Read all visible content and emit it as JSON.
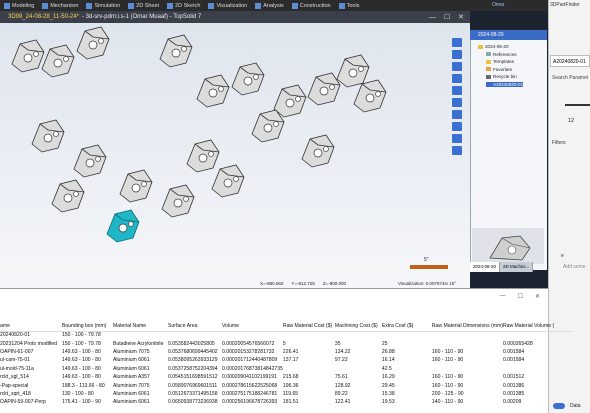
{
  "topbar": {
    "items": [
      "Modeling",
      "Mechanism",
      "Simulation",
      "2D Sheet",
      "2D Sketch",
      "Visualization",
      "Analysis",
      "Construction",
      "Tools"
    ],
    "user": "Omar"
  },
  "titlebar": {
    "doc": "3D99_24-08-28_11-50-24*",
    "rest": "- 3d-srv-pdm:i.s-1 (Omar Muaaf) - TopSolid 7",
    "buttons": [
      "—",
      "☐",
      "✕"
    ]
  },
  "viewport": {
    "coords": [
      "X=-880.560",
      "Y=-812.728",
      "Z=-800.000"
    ],
    "visualization": "Visualization: 0.007874in 15°",
    "ruler_label": "5\""
  },
  "tree": {
    "header": "2024-08-20",
    "items": [
      {
        "label": "2024-08-20",
        "indent": 0,
        "color": "#f0c040"
      },
      {
        "label": "References",
        "indent": 1,
        "color": "#8aa"
      },
      {
        "label": "Templates",
        "indent": 1,
        "color": "#f0c040"
      },
      {
        "label": "Favorites",
        "indent": 1,
        "color": "#e6a23c"
      },
      {
        "label": "Recycle bin",
        "indent": 1,
        "color": "#667"
      },
      {
        "label": "A20240820-01",
        "indent": 1,
        "color": "#3a6cc7",
        "selected": true
      }
    ],
    "tabs": [
      "2024-08-20",
      "2D Machini..."
    ]
  },
  "finder": {
    "title": "3DPartFinder",
    "code": "A20240820-01",
    "search_label": "Search Paramet",
    "number": "12",
    "filters": "Filters",
    "same_label": "e",
    "add_label": "Add some",
    "data_toggle": "Data"
  },
  "table": {
    "headers": [
      "ame",
      "Bounding box (mm)",
      "Material Name",
      "Surface Area",
      "Volume",
      "Raw Material Cost ($)",
      "Machining Cost ($)",
      "Extra Cost ($)",
      "Raw Material Dimensions (mm)",
      "Raw Material Volume ("
    ],
    "rows": [
      [
        "20240820-01",
        "150 - 100 - 79.78",
        "",
        "",
        "",
        "",
        "",
        "",
        "",
        ""
      ],
      [
        "20231204 Proto modified",
        "150 - 100 - 79.78",
        "Butadiene Acrylonitrile",
        "0.053582443025805",
        "0.00020054576566072",
        "5",
        "35",
        "25",
        "",
        "0.000265428"
      ],
      [
        "OAPIN-61-007",
        "149.63 - 100 - 80",
        "Aluminium 7075",
        "0.0537680699445402",
        "0.00020153278281732",
        "226.41",
        "134.22",
        "26.88",
        "160 - 110 - 90",
        "0.001584"
      ],
      [
        "ul-cam-75-01",
        "149.63 - 100 - 80",
        "Aluminium 6061",
        "0.0538095263933129",
        "0.000201712440487809",
        "137.17",
        "97.22",
        "16.14",
        "160 - 110 - 90",
        "0.001584"
      ],
      [
        "ul-mold-75-11a",
        "149.63 - 100 - 80",
        "Aluminium 6061",
        "0.0537258752204394",
        "0.00020176873814842735",
        "",
        "",
        "42.5",
        "",
        ""
      ],
      [
        "rckt_sgl_514",
        "149.63 - 100 - 80",
        "Aluminium A357",
        "0.0545151698591512",
        "0.000209041102199191",
        "215.68",
        "75.61",
        "16.29",
        "160 - 110 - 90",
        "0.001512"
      ],
      [
        "-Pap-special",
        "188.3 - 113.66 - 80",
        "Aluminium 7075",
        "0.0589076969601511",
        "0.000278615622525068",
        "196.36",
        "128.92",
        "29.45",
        "160 - 110 - 90",
        "0.001386"
      ],
      [
        "rckt_sqrt_418",
        "130 - 100 - 80",
        "Aluminium 6061",
        "0.0512673371495158",
        "0.000275175188246781",
        "119.65",
        "89.22",
        "15.38",
        "200 - 125 - 90",
        "0.001385"
      ],
      [
        "OAPIN-59-007-Perp",
        "175.41 - 100 - 90",
        "Aluminium 6061",
        "0.0650938773236938",
        "0.000256196678726393",
        "181.51",
        "122.41",
        "19.53",
        "140 - 110 - 90",
        "0.00209"
      ]
    ]
  }
}
